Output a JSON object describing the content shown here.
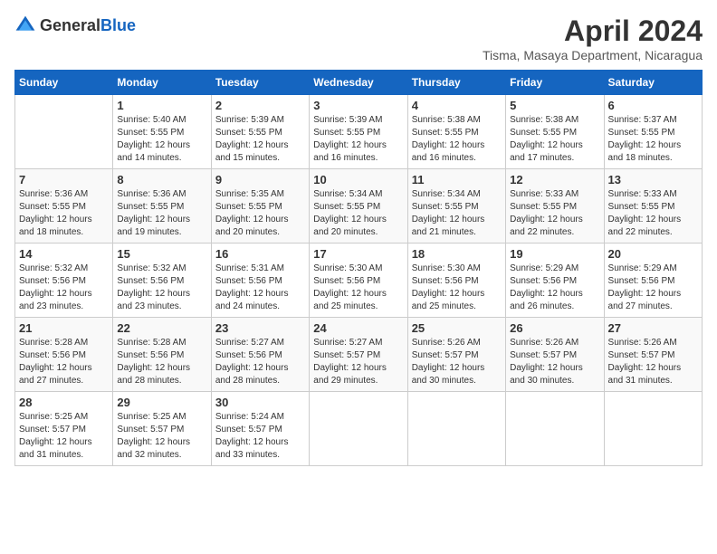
{
  "header": {
    "logo_general": "General",
    "logo_blue": "Blue",
    "title": "April 2024",
    "subtitle": "Tisma, Masaya Department, Nicaragua"
  },
  "calendar": {
    "days_of_week": [
      "Sunday",
      "Monday",
      "Tuesday",
      "Wednesday",
      "Thursday",
      "Friday",
      "Saturday"
    ],
    "weeks": [
      [
        {
          "day": "",
          "sunrise": "",
          "sunset": "",
          "daylight": ""
        },
        {
          "day": "1",
          "sunrise": "Sunrise: 5:40 AM",
          "sunset": "Sunset: 5:55 PM",
          "daylight": "Daylight: 12 hours and 14 minutes."
        },
        {
          "day": "2",
          "sunrise": "Sunrise: 5:39 AM",
          "sunset": "Sunset: 5:55 PM",
          "daylight": "Daylight: 12 hours and 15 minutes."
        },
        {
          "day": "3",
          "sunrise": "Sunrise: 5:39 AM",
          "sunset": "Sunset: 5:55 PM",
          "daylight": "Daylight: 12 hours and 16 minutes."
        },
        {
          "day": "4",
          "sunrise": "Sunrise: 5:38 AM",
          "sunset": "Sunset: 5:55 PM",
          "daylight": "Daylight: 12 hours and 16 minutes."
        },
        {
          "day": "5",
          "sunrise": "Sunrise: 5:38 AM",
          "sunset": "Sunset: 5:55 PM",
          "daylight": "Daylight: 12 hours and 17 minutes."
        },
        {
          "day": "6",
          "sunrise": "Sunrise: 5:37 AM",
          "sunset": "Sunset: 5:55 PM",
          "daylight": "Daylight: 12 hours and 18 minutes."
        }
      ],
      [
        {
          "day": "7",
          "sunrise": "Sunrise: 5:36 AM",
          "sunset": "Sunset: 5:55 PM",
          "daylight": "Daylight: 12 hours and 18 minutes."
        },
        {
          "day": "8",
          "sunrise": "Sunrise: 5:36 AM",
          "sunset": "Sunset: 5:55 PM",
          "daylight": "Daylight: 12 hours and 19 minutes."
        },
        {
          "day": "9",
          "sunrise": "Sunrise: 5:35 AM",
          "sunset": "Sunset: 5:55 PM",
          "daylight": "Daylight: 12 hours and 20 minutes."
        },
        {
          "day": "10",
          "sunrise": "Sunrise: 5:34 AM",
          "sunset": "Sunset: 5:55 PM",
          "daylight": "Daylight: 12 hours and 20 minutes."
        },
        {
          "day": "11",
          "sunrise": "Sunrise: 5:34 AM",
          "sunset": "Sunset: 5:55 PM",
          "daylight": "Daylight: 12 hours and 21 minutes."
        },
        {
          "day": "12",
          "sunrise": "Sunrise: 5:33 AM",
          "sunset": "Sunset: 5:55 PM",
          "daylight": "Daylight: 12 hours and 22 minutes."
        },
        {
          "day": "13",
          "sunrise": "Sunrise: 5:33 AM",
          "sunset": "Sunset: 5:55 PM",
          "daylight": "Daylight: 12 hours and 22 minutes."
        }
      ],
      [
        {
          "day": "14",
          "sunrise": "Sunrise: 5:32 AM",
          "sunset": "Sunset: 5:56 PM",
          "daylight": "Daylight: 12 hours and 23 minutes."
        },
        {
          "day": "15",
          "sunrise": "Sunrise: 5:32 AM",
          "sunset": "Sunset: 5:56 PM",
          "daylight": "Daylight: 12 hours and 23 minutes."
        },
        {
          "day": "16",
          "sunrise": "Sunrise: 5:31 AM",
          "sunset": "Sunset: 5:56 PM",
          "daylight": "Daylight: 12 hours and 24 minutes."
        },
        {
          "day": "17",
          "sunrise": "Sunrise: 5:30 AM",
          "sunset": "Sunset: 5:56 PM",
          "daylight": "Daylight: 12 hours and 25 minutes."
        },
        {
          "day": "18",
          "sunrise": "Sunrise: 5:30 AM",
          "sunset": "Sunset: 5:56 PM",
          "daylight": "Daylight: 12 hours and 25 minutes."
        },
        {
          "day": "19",
          "sunrise": "Sunrise: 5:29 AM",
          "sunset": "Sunset: 5:56 PM",
          "daylight": "Daylight: 12 hours and 26 minutes."
        },
        {
          "day": "20",
          "sunrise": "Sunrise: 5:29 AM",
          "sunset": "Sunset: 5:56 PM",
          "daylight": "Daylight: 12 hours and 27 minutes."
        }
      ],
      [
        {
          "day": "21",
          "sunrise": "Sunrise: 5:28 AM",
          "sunset": "Sunset: 5:56 PM",
          "daylight": "Daylight: 12 hours and 27 minutes."
        },
        {
          "day": "22",
          "sunrise": "Sunrise: 5:28 AM",
          "sunset": "Sunset: 5:56 PM",
          "daylight": "Daylight: 12 hours and 28 minutes."
        },
        {
          "day": "23",
          "sunrise": "Sunrise: 5:27 AM",
          "sunset": "Sunset: 5:56 PM",
          "daylight": "Daylight: 12 hours and 28 minutes."
        },
        {
          "day": "24",
          "sunrise": "Sunrise: 5:27 AM",
          "sunset": "Sunset: 5:57 PM",
          "daylight": "Daylight: 12 hours and 29 minutes."
        },
        {
          "day": "25",
          "sunrise": "Sunrise: 5:26 AM",
          "sunset": "Sunset: 5:57 PM",
          "daylight": "Daylight: 12 hours and 30 minutes."
        },
        {
          "day": "26",
          "sunrise": "Sunrise: 5:26 AM",
          "sunset": "Sunset: 5:57 PM",
          "daylight": "Daylight: 12 hours and 30 minutes."
        },
        {
          "day": "27",
          "sunrise": "Sunrise: 5:26 AM",
          "sunset": "Sunset: 5:57 PM",
          "daylight": "Daylight: 12 hours and 31 minutes."
        }
      ],
      [
        {
          "day": "28",
          "sunrise": "Sunrise: 5:25 AM",
          "sunset": "Sunset: 5:57 PM",
          "daylight": "Daylight: 12 hours and 31 minutes."
        },
        {
          "day": "29",
          "sunrise": "Sunrise: 5:25 AM",
          "sunset": "Sunset: 5:57 PM",
          "daylight": "Daylight: 12 hours and 32 minutes."
        },
        {
          "day": "30",
          "sunrise": "Sunrise: 5:24 AM",
          "sunset": "Sunset: 5:57 PM",
          "daylight": "Daylight: 12 hours and 33 minutes."
        },
        {
          "day": "",
          "sunrise": "",
          "sunset": "",
          "daylight": ""
        },
        {
          "day": "",
          "sunrise": "",
          "sunset": "",
          "daylight": ""
        },
        {
          "day": "",
          "sunrise": "",
          "sunset": "",
          "daylight": ""
        },
        {
          "day": "",
          "sunrise": "",
          "sunset": "",
          "daylight": ""
        }
      ]
    ]
  }
}
